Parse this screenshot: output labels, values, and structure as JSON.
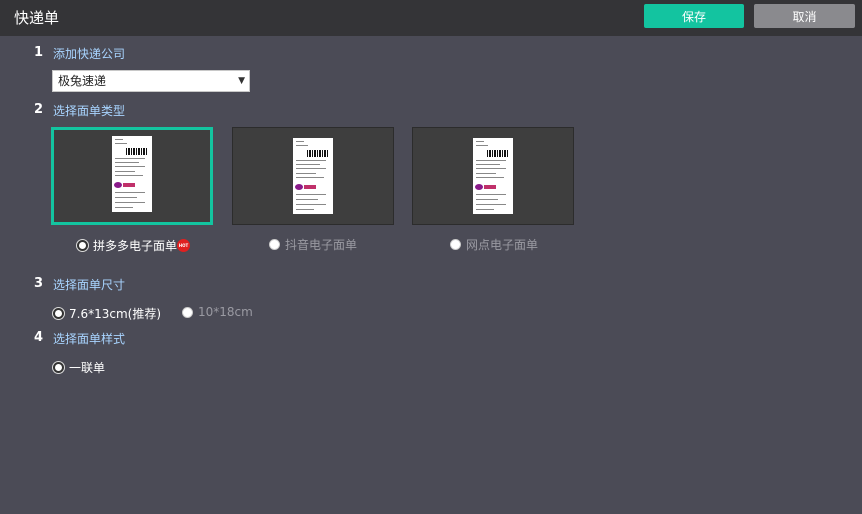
{
  "header": {
    "title": "快递单",
    "save_label": "保存",
    "cancel_label": "取消"
  },
  "steps": [
    {
      "num": "1",
      "label": "添加快递公司"
    },
    {
      "num": "2",
      "label": "选择面单类型"
    },
    {
      "num": "3",
      "label": "选择面单尺寸"
    },
    {
      "num": "4",
      "label": "选择面单样式"
    }
  ],
  "company_select": {
    "value": "极兔速递",
    "arrow": "▼"
  },
  "waybill_types": [
    {
      "label": "拼多多电子面单",
      "selected": true,
      "badge": "HOT"
    },
    {
      "label": "抖音电子面单",
      "selected": false
    },
    {
      "label": "网点电子面单",
      "selected": false
    }
  ],
  "sizes": [
    {
      "label": "7.6*13cm(推荐)",
      "selected": true
    },
    {
      "label": "10*18cm",
      "selected": false
    }
  ],
  "styles": [
    {
      "label": "一联单",
      "selected": true
    }
  ],
  "colors": {
    "accent": "#13c4a0",
    "background": "#4b4b56",
    "header": "#343437",
    "link": "#a8d4ff"
  }
}
